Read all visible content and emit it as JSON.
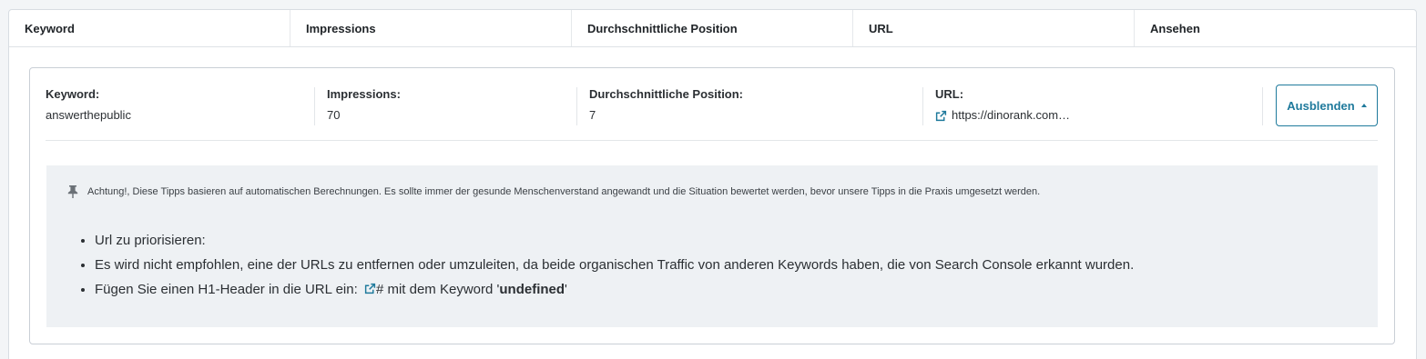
{
  "table_header": [
    "Keyword",
    "Impressions",
    "Durchschnittliche Position",
    "URL",
    "Ansehen"
  ],
  "detail": {
    "keyword_label": "Keyword:",
    "keyword_value": "answerthepublic",
    "impressions_label": "Impressions:",
    "impressions_value": "70",
    "position_label": "Durchschnittliche Position:",
    "position_value": "7",
    "url_label": "URL:",
    "url_value": "https://dinorank.com…",
    "hide_button": "Ausblenden"
  },
  "tips": {
    "notice": "Achtung!, Diese Tipps basieren auf automatischen Berechnungen. Es sollte immer der gesunde Menschenverstand angewandt und die Situation bewertet werden, bevor unsere Tipps in die Praxis umgesetzt werden.",
    "items": [
      "Url zu priorisieren:",
      "Es wird nicht empfohlen, eine der URLs zu entfernen oder umzuleiten, da beide organischen Traffic von anderen Keywords haben, die von Search Console erkannt wurden."
    ],
    "h1_prefix": "Fügen Sie einen H1-Header in die URL ein: ",
    "h1_hash": "#",
    "h1_middle": " mit dem Keyword '",
    "h1_keyword": "undefined",
    "h1_suffix": "'"
  },
  "colors": {
    "accent": "#1f7a9c",
    "tips_background": "#eef1f4",
    "page_background": "#f3f5f7"
  },
  "icons": [
    "external-link-icon",
    "pin-icon",
    "caret-up-icon"
  ]
}
